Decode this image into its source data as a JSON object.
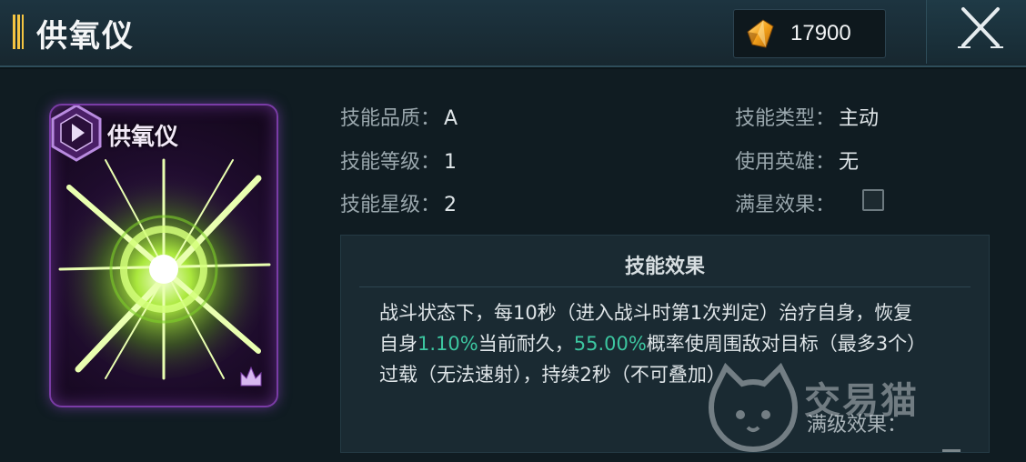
{
  "header": {
    "title": "供氧仪",
    "currency_value": "17900",
    "currency_icon": "crystal-icon",
    "close_icon": "close-icon"
  },
  "card": {
    "name": "供氧仪",
    "badge_icon": "hexagon-play-icon",
    "rank_icon": "rank-crown-icon",
    "frame_color": "#7a3ca6",
    "glow_color": "#a8ff3c"
  },
  "stats": {
    "quality_label": "技能品质：",
    "quality_value": "A",
    "level_label": "技能等级：",
    "level_value": "1",
    "star_label": "技能星级：",
    "star_value": "2",
    "type_label": "技能类型：",
    "type_value": "主动",
    "hero_label": "使用英雄：",
    "hero_value": "无",
    "fullstar_label": "满星效果："
  },
  "effect": {
    "title": "技能效果",
    "text_1": "战斗状态下，每10秒（进入战斗时第1次判定）治疗自身，恢复自身",
    "highlight_1": "1.10%",
    "text_2": "当前耐久，",
    "highlight_2": "55.00%",
    "text_3": "概率使周围敌对目标（最多3个）过载（无法速射），持续2秒（不可叠加）",
    "highlight_color": "#3cc6a0",
    "max_level_label": "满级效果："
  },
  "watermark": {
    "text": "交易猫"
  }
}
